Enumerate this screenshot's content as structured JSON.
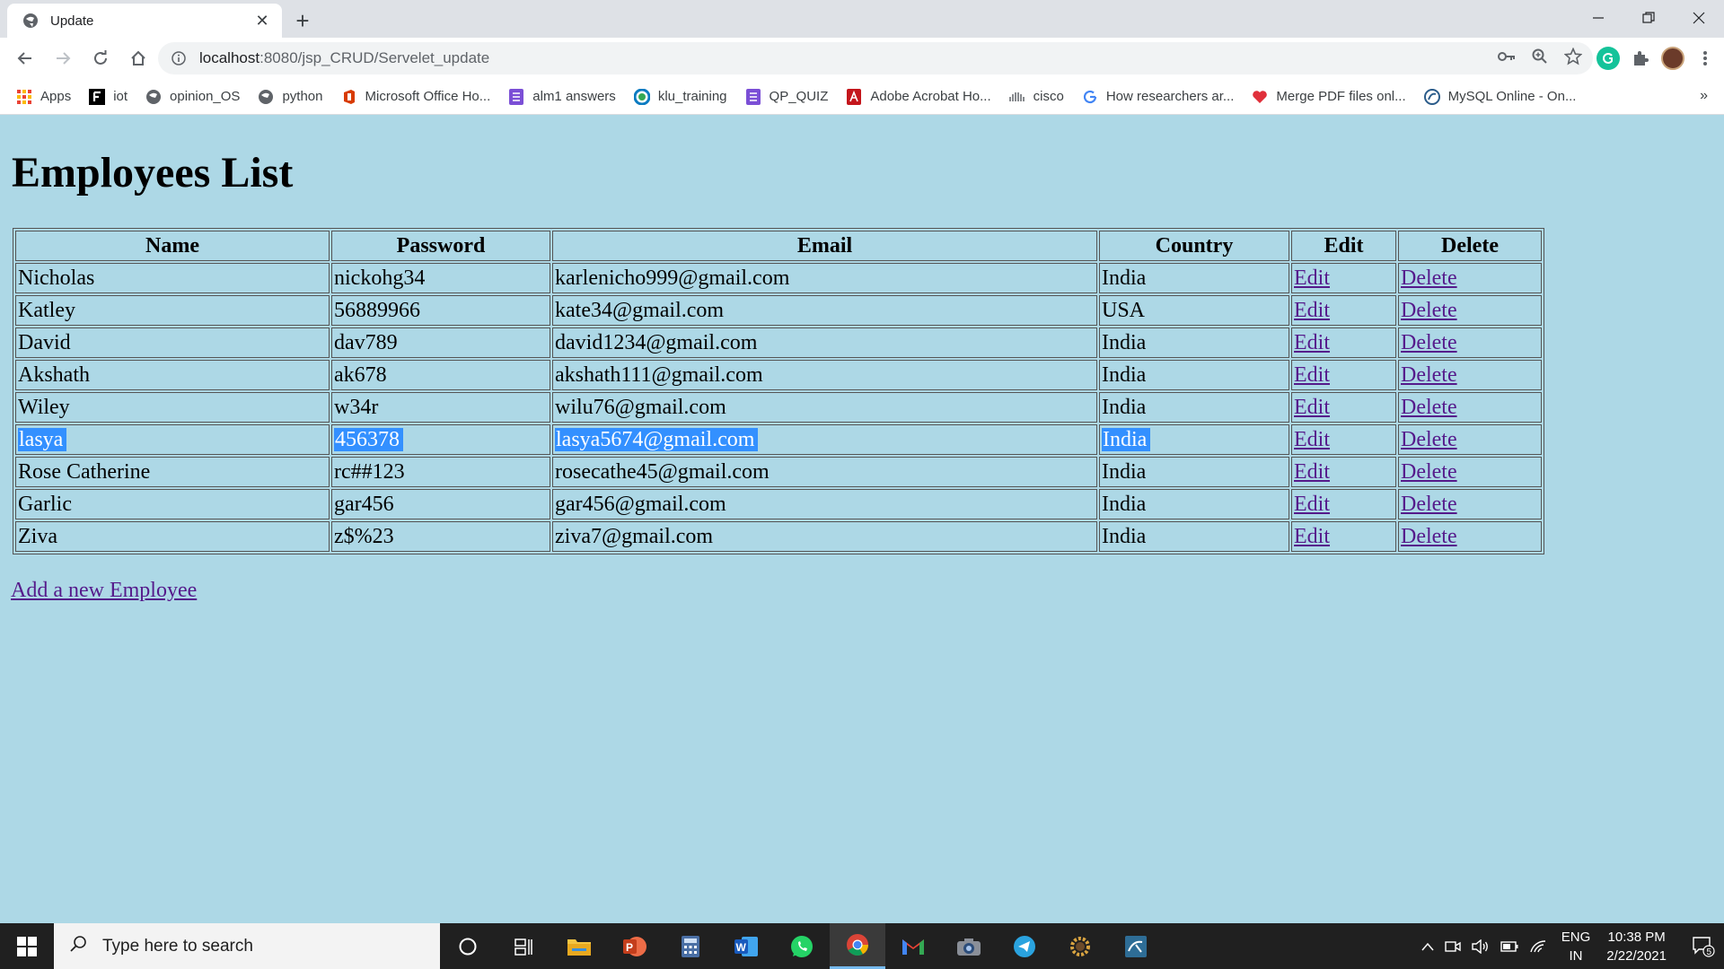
{
  "browser": {
    "tab_title": "Update",
    "new_tab_symbol": "+",
    "url_host": "localhost",
    "url_path": ":8080/jsp_CRUD/Servelet_update",
    "bookmarks": [
      {
        "label": "Apps",
        "icon": "apps-grid-icon"
      },
      {
        "label": "iot",
        "icon": "f-logo-icon"
      },
      {
        "label": "opinion_OS",
        "icon": "globe-icon"
      },
      {
        "label": "python",
        "icon": "globe-icon"
      },
      {
        "label": "Microsoft Office Ho...",
        "icon": "office-icon"
      },
      {
        "label": "alm1 answers",
        "icon": "forms-icon"
      },
      {
        "label": "klu_training",
        "icon": "circle-logo-icon"
      },
      {
        "label": "QP_QUIZ",
        "icon": "forms-icon"
      },
      {
        "label": "Adobe Acrobat Ho...",
        "icon": "acrobat-icon"
      },
      {
        "label": "cisco",
        "icon": "cisco-icon"
      },
      {
        "label": "How researchers ar...",
        "icon": "google-icon"
      },
      {
        "label": "Merge PDF files onl...",
        "icon": "heart-icon"
      },
      {
        "label": "MySQL Online - On...",
        "icon": "mysql-icon"
      }
    ],
    "bookmarks_more": "»"
  },
  "page": {
    "title": "Employees List",
    "columns": [
      "Name",
      "Password",
      "Email",
      "Country",
      "Edit",
      "Delete"
    ],
    "rows": [
      {
        "name": "Nicholas",
        "password": "nickohg34",
        "email": "karlenicho999@gmail.com",
        "country": "India",
        "edit": "Edit",
        "delete": "Delete"
      },
      {
        "name": "Katley",
        "password": "56889966",
        "email": "kate34@gmail.com",
        "country": "USA",
        "edit": "Edit",
        "delete": "Delete"
      },
      {
        "name": "David",
        "password": "dav789",
        "email": "david1234@gmail.com",
        "country": "India",
        "edit": "Edit",
        "delete": "Delete"
      },
      {
        "name": "Akshath",
        "password": "ak678",
        "email": "akshath111@gmail.com",
        "country": "India",
        "edit": "Edit",
        "delete": "Delete"
      },
      {
        "name": "Wiley",
        "password": "w34r",
        "email": "wilu76@gmail.com",
        "country": "India",
        "edit": "Edit",
        "delete": "Delete"
      },
      {
        "name": "lasya",
        "password": "456378",
        "email": "lasya5674@gmail.com",
        "country": "India",
        "edit": "Edit",
        "delete": "Delete",
        "selected": true
      },
      {
        "name": "Rose Catherine",
        "password": "rc##123",
        "email": "rosecathe45@gmail.com",
        "country": "India",
        "edit": "Edit",
        "delete": "Delete"
      },
      {
        "name": "Garlic",
        "password": "gar456",
        "email": "gar456@gmail.com",
        "country": "India",
        "edit": "Edit",
        "delete": "Delete"
      },
      {
        "name": "Ziva",
        "password": "z$%23",
        "email": "ziva7@gmail.com",
        "country": "India",
        "edit": "Edit",
        "delete": "Delete"
      }
    ],
    "add_link": "Add a new Employee"
  },
  "taskbar": {
    "search_placeholder": "Type here to search",
    "lang_top": "ENG",
    "lang_bottom": "IN",
    "time": "10:38 PM",
    "date": "2/22/2021",
    "notification_count": "5"
  },
  "colors": {
    "page_bg": "#add8e6",
    "link": "#551a8b",
    "selection": "#3390ff"
  }
}
